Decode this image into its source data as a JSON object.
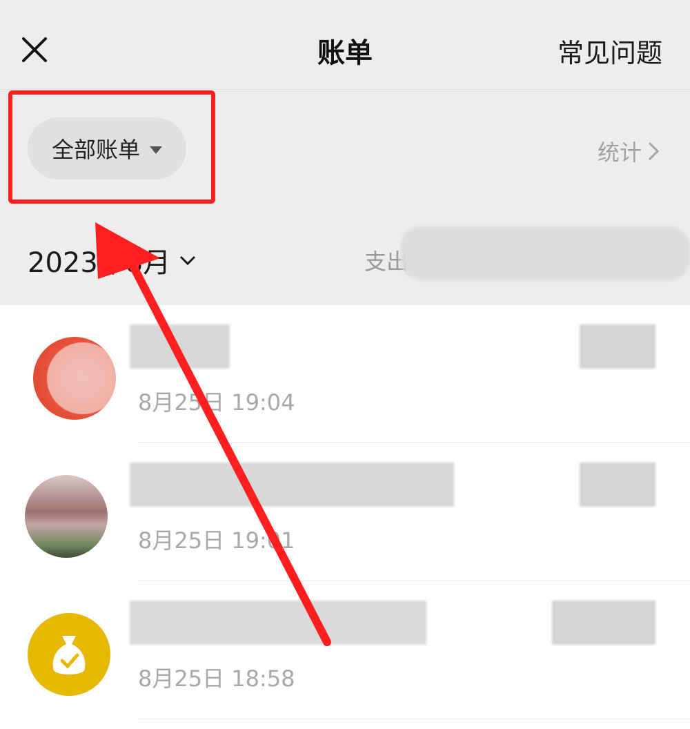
{
  "header": {
    "title": "账单",
    "faq_label": "常见问题"
  },
  "filter": {
    "selected_label": "全部账单",
    "stats_label": "统计"
  },
  "month": {
    "label": "2023年8月",
    "summary_prefix": "支出"
  },
  "transactions": [
    {
      "time": "8月25日 19:04",
      "avatar_color": "#e8533d"
    },
    {
      "time": "8月25日 19:01",
      "avatar_color": "#8c6b6b"
    },
    {
      "time": "8月25日 18:58",
      "avatar_color": "#e6b800"
    }
  ],
  "annotation": {
    "highlight_color": "#ff1f1f",
    "arrow_color": "#ff1f1f"
  }
}
